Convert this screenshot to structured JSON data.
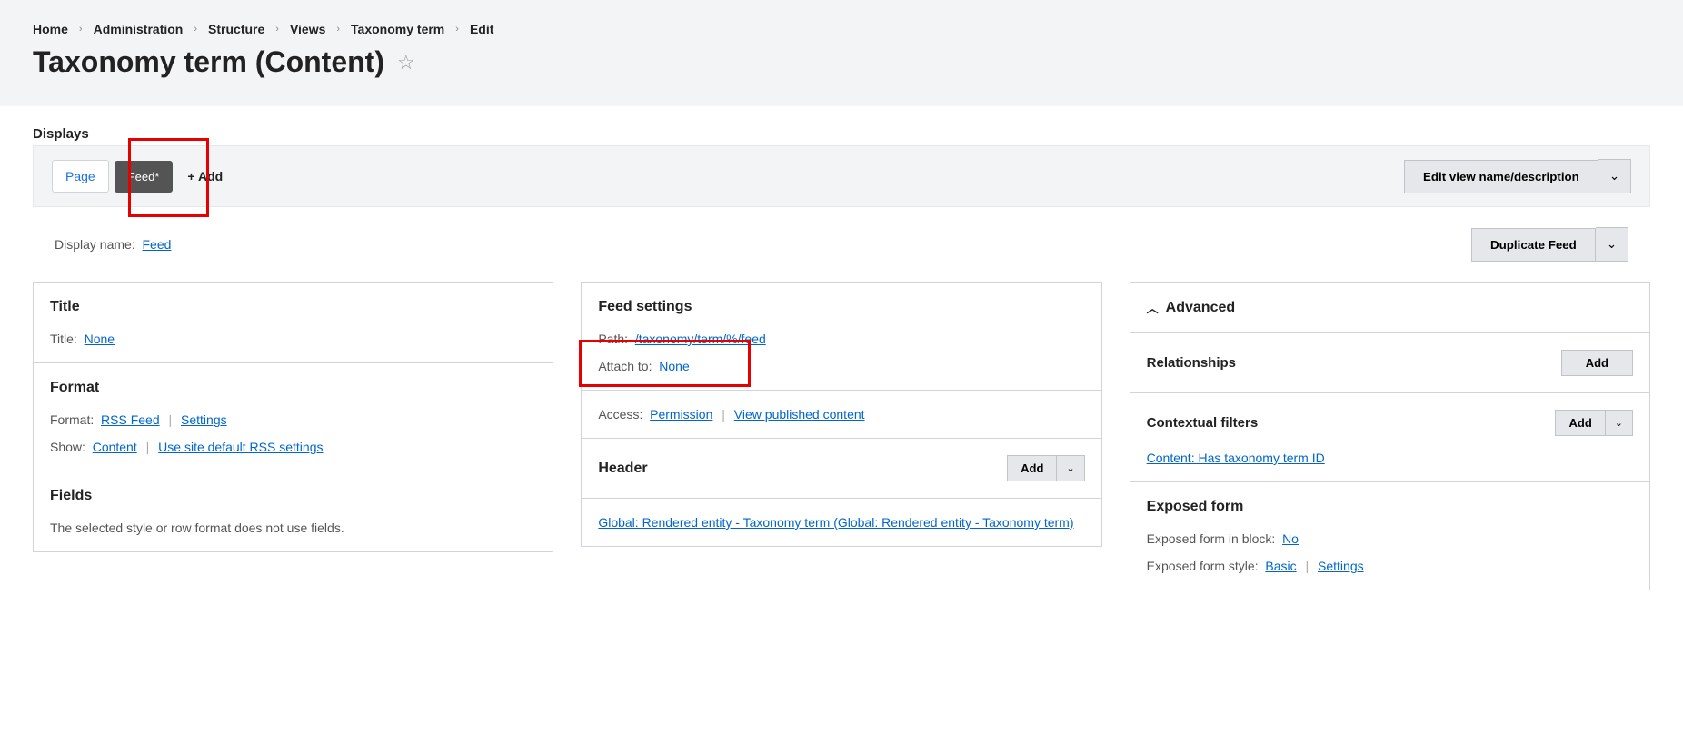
{
  "breadcrumb": [
    "Home",
    "Administration",
    "Structure",
    "Views",
    "Taxonomy term",
    "Edit"
  ],
  "page_title": "Taxonomy term (Content)",
  "displays_label": "Displays",
  "tabs": {
    "page": "Page",
    "feed": "Feed*",
    "add": "+ Add"
  },
  "edit_view_btn": "Edit view name/description",
  "display_name": {
    "label": "Display name:",
    "value": "Feed"
  },
  "duplicate_btn": "Duplicate Feed",
  "col1": {
    "title_h": "Title",
    "title_label": "Title:",
    "title_value": "None",
    "format_h": "Format",
    "format_label": "Format:",
    "format_value": "RSS Feed",
    "format_settings": "Settings",
    "show_label": "Show:",
    "show_value": "Content",
    "show_settings": "Use site default RSS settings",
    "fields_h": "Fields",
    "fields_text": "The selected style or row format does not use fields."
  },
  "col2": {
    "feed_h": "Feed settings",
    "path_label": "Path:",
    "path_value": "/taxonomy/term/%/feed",
    "attach_label": "Attach to:",
    "attach_value": "None",
    "access_label": "Access:",
    "access_value": "Permission",
    "access_detail": "View published content",
    "header_h": "Header",
    "header_add": "Add",
    "header_link": "Global: Rendered entity - Taxonomy term (Global: Rendered entity - Taxonomy term)"
  },
  "col3": {
    "advanced": "Advanced",
    "rel_h": "Relationships",
    "rel_add": "Add",
    "ctx_h": "Contextual filters",
    "ctx_add": "Add",
    "ctx_link": "Content: Has taxonomy term ID",
    "exp_h": "Exposed form",
    "exp_block_label": "Exposed form in block:",
    "exp_block_value": "No",
    "exp_style_label": "Exposed form style:",
    "exp_style_value": "Basic",
    "exp_style_settings": "Settings"
  }
}
